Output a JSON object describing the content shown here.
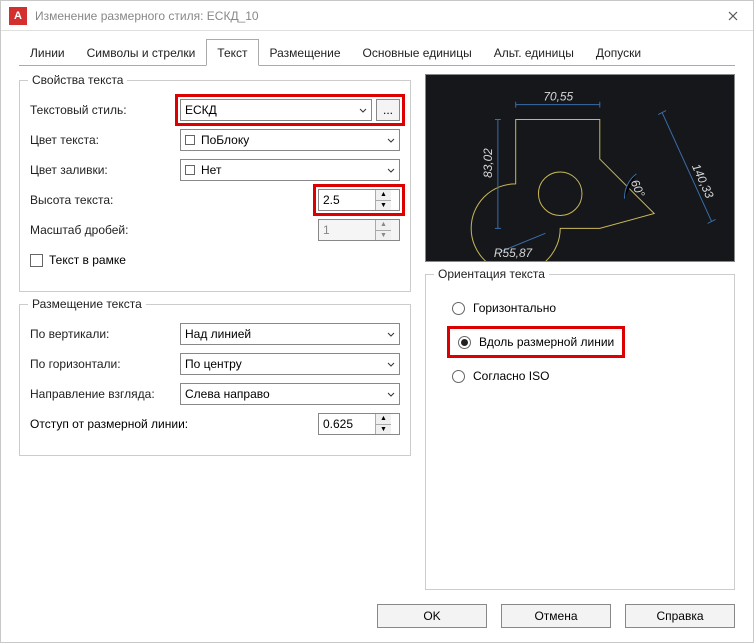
{
  "window": {
    "title": "Изменение размерного стиля: ЕСКД_10"
  },
  "tabs": [
    "Линии",
    "Символы и стрелки",
    "Текст",
    "Размещение",
    "Основные единицы",
    "Альт. единицы",
    "Допуски"
  ],
  "active_tab": "Текст",
  "text_props": {
    "legend": "Свойства текста",
    "style_label": "Текстовый стиль:",
    "style_value": "ЕСКД",
    "style_btn": "...",
    "color_label": "Цвет текста:",
    "color_value": "ПоБлоку",
    "fill_label": "Цвет заливки:",
    "fill_value": "Нет",
    "height_label": "Высота текста:",
    "height_value": "2.5",
    "frac_label": "Масштаб дробей:",
    "frac_value": "1",
    "frame_label": "Текст в рамке"
  },
  "placement": {
    "legend": "Размещение текста",
    "vert_label": "По вертикали:",
    "vert_value": "Над линией",
    "horiz_label": "По горизонтали:",
    "horiz_value": "По центру",
    "dir_label": "Направление взгляда:",
    "dir_value": "Слева направо",
    "offset_label": "Отступ от размерной линии:",
    "offset_value": "0.625"
  },
  "orient": {
    "legend": "Ориентация текста",
    "opt1": "Горизонтально",
    "opt2": "Вдоль размерной линии",
    "opt3": "Согласно ISO",
    "selected": "opt2"
  },
  "preview": {
    "d1": "70,55",
    "d2": "83,02",
    "d3": "140,33",
    "d4": "R55,87",
    "d5": "60°"
  },
  "buttons": {
    "ok": "OK",
    "cancel": "Отмена",
    "help": "Справка"
  }
}
